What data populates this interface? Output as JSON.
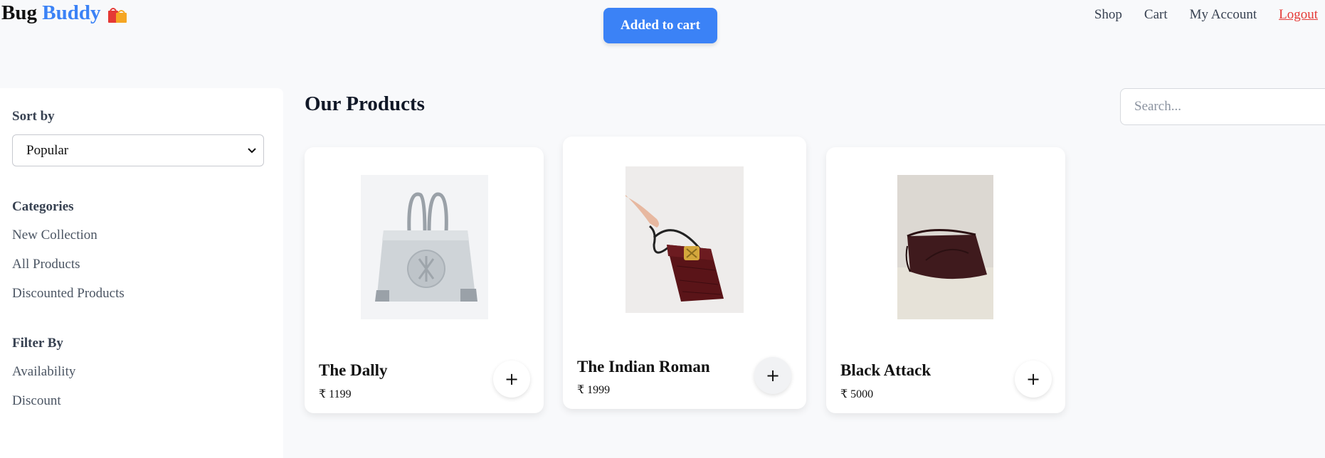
{
  "header": {
    "brand_part1": "Bug",
    "brand_part2": "Buddy",
    "nav": [
      "Shop",
      "Cart",
      "My Account",
      "Logout"
    ]
  },
  "toast": {
    "message": "Added to cart"
  },
  "sidebar": {
    "sort_heading": "Sort by",
    "sort_selected": "Popular",
    "categories_heading": "Categories",
    "categories": [
      "New Collection",
      "All Products",
      "Discounted Products"
    ],
    "filter_heading": "Filter By",
    "filters": [
      "Availability",
      "Discount"
    ]
  },
  "main": {
    "title": "Our Products",
    "search_placeholder": "Search...",
    "products": [
      {
        "name": "The Dally",
        "price": "₹ 1199",
        "add_symbol": "+"
      },
      {
        "name": "The Indian Roman",
        "price": "₹ 1999",
        "add_symbol": "+"
      },
      {
        "name": "Black Attack",
        "price": "₹ 5000",
        "add_symbol": "+"
      }
    ]
  },
  "colors": {
    "accent": "#3b82f6",
    "logout": "#e53935",
    "background": "#f8f9fb"
  }
}
